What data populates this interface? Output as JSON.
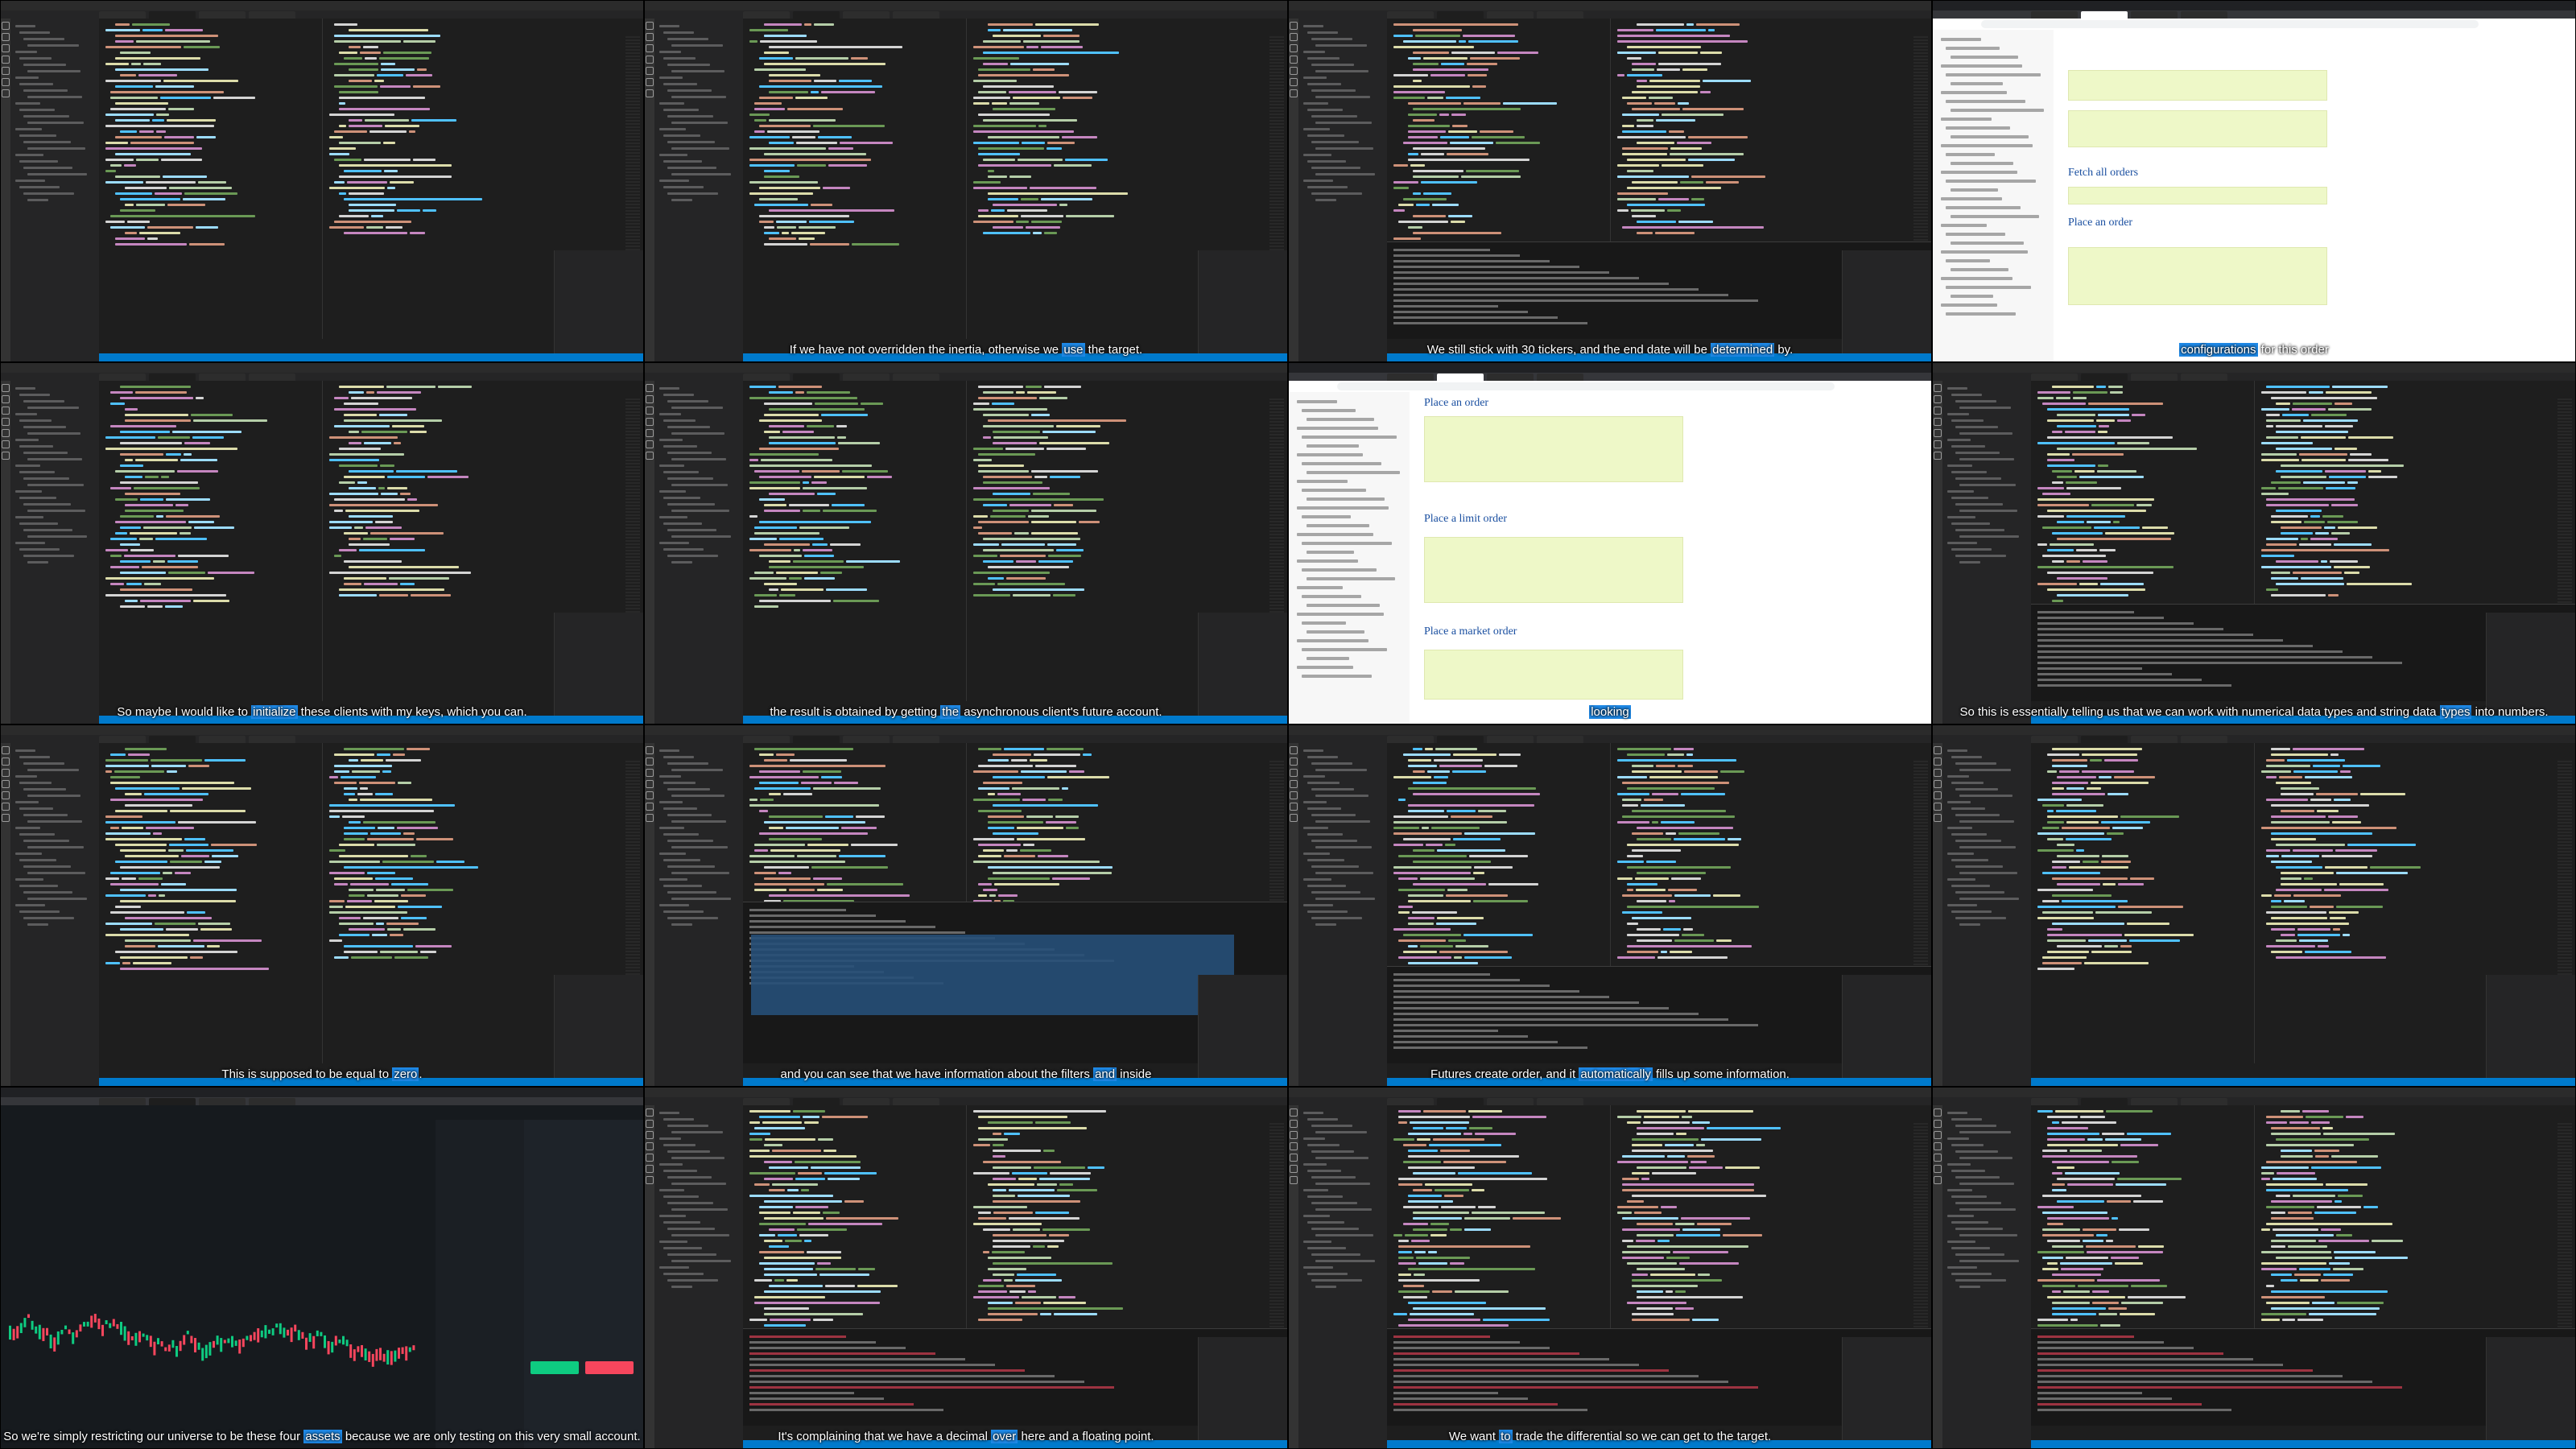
{
  "captions": [
    {
      "before": "",
      "highlight": "",
      "after": ""
    },
    {
      "before": "If we have not overridden the inertia, otherwise we ",
      "highlight": "use",
      "after": " the target."
    },
    {
      "before": "We still stick with 30 tickers, and the end date will be ",
      "highlight": "determined",
      "after": " by."
    },
    {
      "before": "",
      "highlight": "configurations",
      "after": " for this order"
    },
    {
      "before": "So maybe I would like to ",
      "highlight": "initialize",
      "after": " these clients with my keys, which you can."
    },
    {
      "before": "the result is obtained by getting ",
      "highlight": "the",
      "after": " asynchronous client's future account."
    },
    {
      "before": "",
      "highlight": "looking",
      "after": ""
    },
    {
      "before": "So this is essentially telling us that we can work with numerical data types and string data ",
      "highlight": "types",
      "after": " into numbers."
    },
    {
      "before": "This is supposed to be equal to ",
      "highlight": "zero",
      "after": "."
    },
    {
      "before": "and you can see that we have information about the filters ",
      "highlight": "and",
      "after": " inside"
    },
    {
      "before": "Futures create order, and it ",
      "highlight": "automatically",
      "after": " fills up some information."
    },
    {
      "before": "",
      "highlight": "",
      "after": ""
    },
    {
      "before": "So we're simply restricting our universe to be these four ",
      "highlight": "assets",
      "after": " because we are only testing on this very small account."
    },
    {
      "before": "It's complaining that we have a decimal ",
      "highlight": "over",
      "after": " here and a floating point."
    },
    {
      "before": "We want ",
      "highlight": "to",
      "after": " trade the differential so we can get to the target."
    },
    {
      "before": "",
      "highlight": "",
      "after": ""
    }
  ],
  "doc": {
    "fetch_all_orders": "Fetch all orders",
    "place_an_order": "Place an order",
    "place_a_limit_order": "Place a limit order",
    "place_a_market_order": "Place a market order"
  },
  "colors": {
    "editor_bg": "#1e1e1e",
    "sidebar_bg": "#252526",
    "statusbar": "#007acc",
    "caption_highlight": "#1e88e5",
    "keyword": "#c586c0",
    "string": "#ce9178",
    "func": "#dcdcaa",
    "var": "#9cdcfe",
    "comment": "#6a9955",
    "buy": "#0ecb81",
    "sell": "#f6465d"
  },
  "icons": [
    "explorer-icon",
    "search-icon",
    "source-control-icon",
    "run-debug-icon",
    "extensions-icon",
    "account-icon",
    "settings-icon"
  ]
}
